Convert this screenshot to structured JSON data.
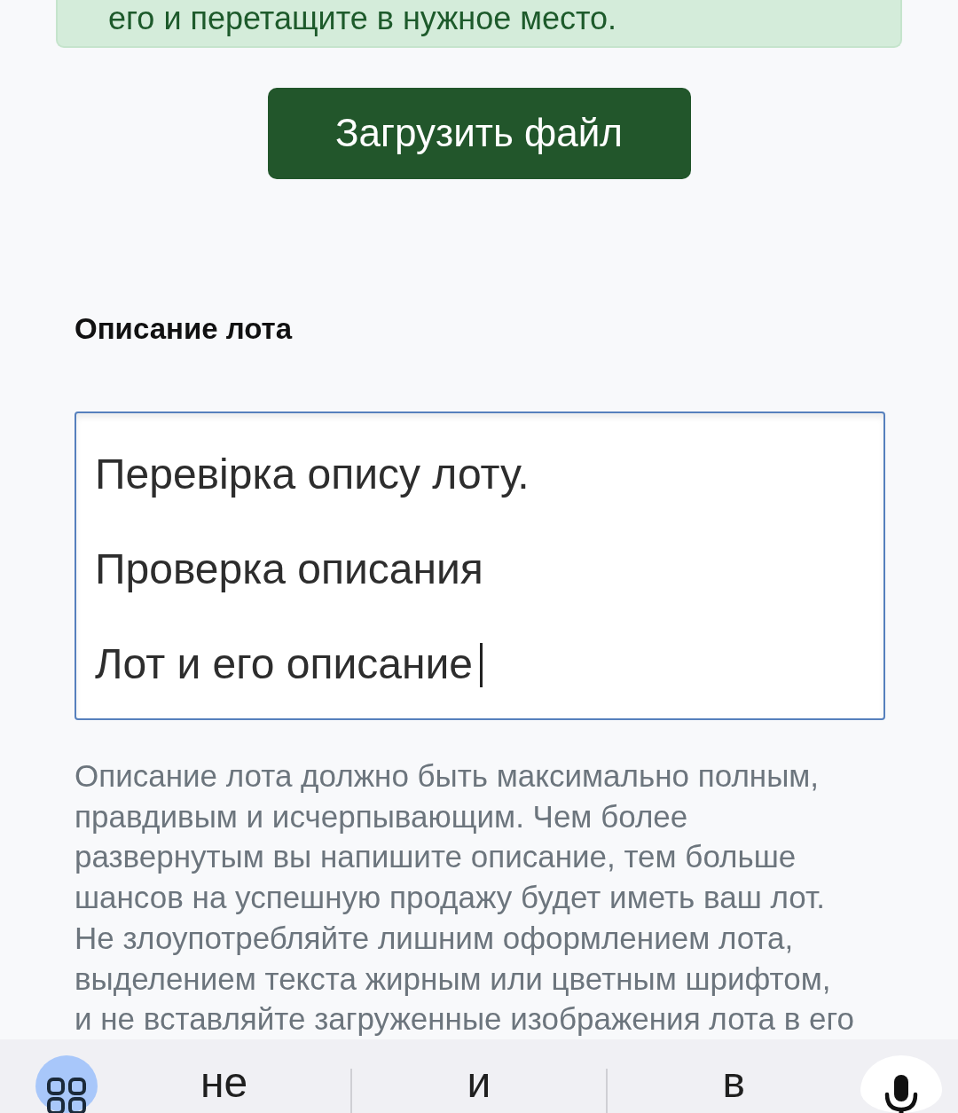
{
  "notice": {
    "text": "его и перетащите в нужное место."
  },
  "upload_button": {
    "label": "Загрузить файл"
  },
  "description": {
    "label": "Описание лота",
    "value": "Перевірка опису лоту.\n\nПроверка описания\n\nЛот и его описание",
    "focused": true
  },
  "help_text": "Описание лота должно быть максимально полным,\nправдивым и исчерпывающим. Чем более\nразвернутым вы напишите описание, тем больше\nшансов на успешную продажу будет иметь ваш лот.\nНе злоупотребляйте лишним оформлением лота,\nвыделением текста жирным или цветным шрифтом,\nи не вставляйте загруженные изображения лота в его",
  "keyboard": {
    "suggestions": [
      "не",
      "и",
      "в"
    ]
  }
}
